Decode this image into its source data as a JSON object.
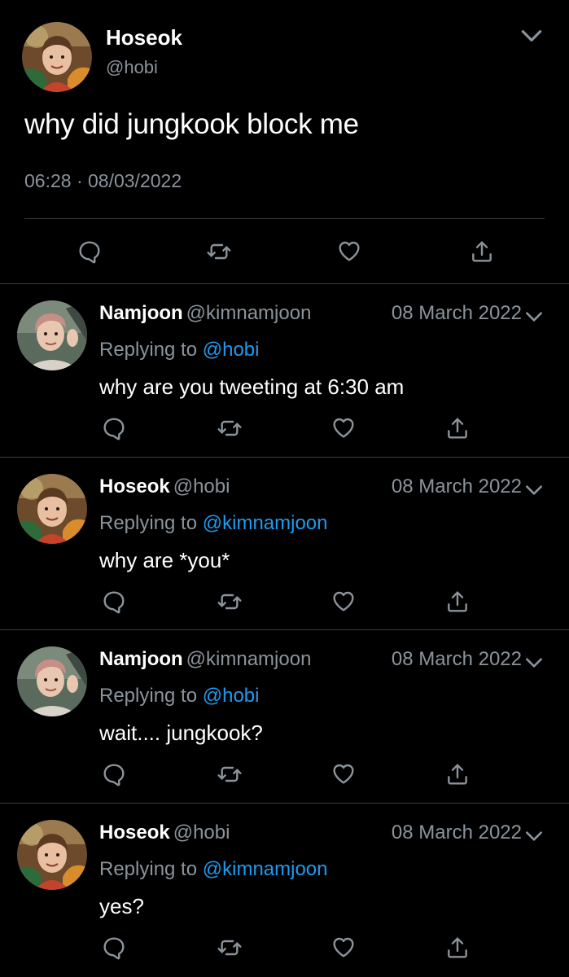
{
  "main_tweet": {
    "name": "Hoseok",
    "handle": "@hobi",
    "text": "why did jungkook block me",
    "timestamp": "06:28 · 08/03/2022",
    "avatar": "hoseok-avatar"
  },
  "replies": [
    {
      "name": "Namjoon",
      "handle": "@kimnamjoon",
      "date": "08 March 2022",
      "replying_prefix": "Replying to",
      "replying_to": "@hobi",
      "text": "why are you tweeting at 6:30 am",
      "avatar": "namjoon-avatar"
    },
    {
      "name": "Hoseok",
      "handle": "@hobi",
      "date": "08 March 2022",
      "replying_prefix": "Replying to",
      "replying_to": "@kimnamjoon",
      "text": "why are *you*",
      "avatar": "hoseok-avatar"
    },
    {
      "name": "Namjoon",
      "handle": "@kimnamjoon",
      "date": "08 March 2022",
      "replying_prefix": "Replying to",
      "replying_to": "@hobi",
      "text": "wait.... jungkook?",
      "avatar": "namjoon-avatar"
    },
    {
      "name": "Hoseok",
      "handle": "@hobi",
      "date": "08 March 2022",
      "replying_prefix": "Replying to",
      "replying_to": "@kimnamjoon",
      "text": "yes?",
      "avatar": "hoseok-avatar"
    }
  ],
  "icons": [
    "reply-icon",
    "retweet-icon",
    "like-icon",
    "share-icon",
    "chevron-down-icon"
  ],
  "colors": {
    "background": "#000000",
    "secondary_text": "#8b939b",
    "link": "#1d9bf0",
    "divider": "#2f3336"
  }
}
